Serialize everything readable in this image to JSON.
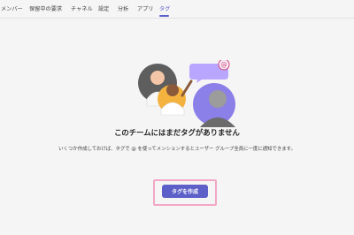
{
  "tabs": [
    {
      "label": "メンバー"
    },
    {
      "label": "保留中の要求"
    },
    {
      "label": "チャネル"
    },
    {
      "label": "設定"
    },
    {
      "label": "分析"
    },
    {
      "label": "アプリ"
    },
    {
      "label": "タグ",
      "active": true
    }
  ],
  "illustration": {
    "icon": "tags-people-illustration",
    "mention_badge_symbol": "@"
  },
  "empty_state": {
    "title": "このチームにはまだタグがありません",
    "description": "いくつか作成しておけば、タグで @ を使ってメンションするとユーザー グループ全員に一度に通知できます。",
    "create_button_label": "タグを作成"
  },
  "colors": {
    "accent": "#5b5fc7",
    "highlight_border": "#f2a7c7",
    "background": "#f5f5f5"
  }
}
